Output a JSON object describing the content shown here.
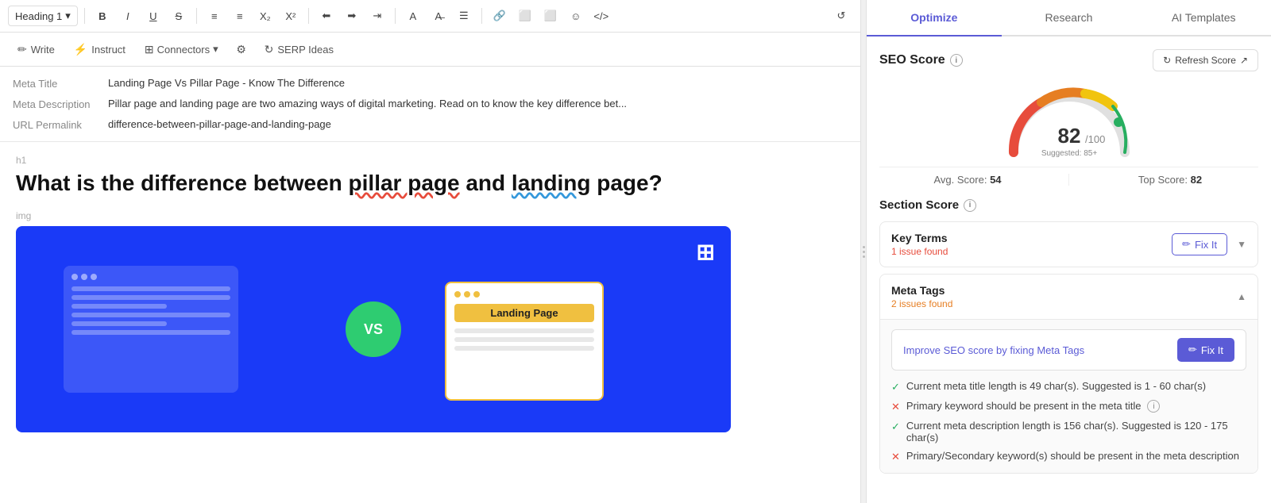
{
  "toolbar": {
    "heading_label": "Heading 1",
    "buttons": [
      "B",
      "I",
      "U",
      "S",
      "OL",
      "UL",
      "X₂",
      "X²",
      "Align-L",
      "Align-R",
      "Indent",
      "Color",
      "Clear",
      "Align",
      "Link",
      "Image",
      "Media",
      "Emoji",
      "Code"
    ],
    "history_icon": "↺"
  },
  "secondary_toolbar": {
    "write_label": "Write",
    "instruct_label": "Instruct",
    "connectors_label": "Connectors",
    "settings_icon": "⚙",
    "serp_label": "SERP Ideas"
  },
  "meta": {
    "title_label": "Meta Title",
    "title_value": "Landing Page Vs Pillar Page - Know The Difference",
    "description_label": "Meta Description",
    "description_value": "Pillar page and landing page are two amazing ways of digital marketing. Read on to know the key difference bet...",
    "url_label": "URL Permalink",
    "url_value": "difference-between-pillar-page-and-landing-page"
  },
  "content": {
    "h1_indicator": "h1",
    "img_indicator": "img",
    "title_part1": "What is the difference between ",
    "title_highlight1": "pillar page",
    "title_part2": " and ",
    "title_highlight2": "landing",
    "title_part3": " page?",
    "vs_text": "VS",
    "landing_page_label": "Landing Page"
  },
  "right_panel": {
    "tabs": [
      {
        "label": "Optimize",
        "active": true
      },
      {
        "label": "Research",
        "active": false
      },
      {
        "label": "AI Templates",
        "active": false
      }
    ],
    "seo_score": {
      "title": "SEO Score",
      "refresh_label": "Refresh Score",
      "score": "82",
      "score_max": "/100",
      "suggested": "Suggested: 85+",
      "avg_score_label": "Avg. Score:",
      "avg_score_value": "54",
      "top_score_label": "Top Score:",
      "top_score_value": "82"
    },
    "section_score": {
      "title": "Section Score",
      "items": [
        {
          "name": "Key Terms",
          "issues": "1 issue found",
          "fix_label": "Fix It",
          "expanded": false
        },
        {
          "name": "Meta Tags",
          "issues": "2 issues found",
          "fix_label": "Fix It",
          "expanded": true,
          "improve_text": "Improve SEO score by fixing Meta Tags",
          "fix_primary_label": "Fix It",
          "checks": [
            {
              "pass": true,
              "text": "Current meta title length is 49 char(s). Suggested is 1 - 60 char(s)"
            },
            {
              "pass": false,
              "text": "Primary keyword should be present in the meta title"
            },
            {
              "pass": true,
              "text": "Current meta description length is 156 char(s). Suggested is 120 - 175 char(s)"
            },
            {
              "pass": false,
              "text": "Primary/Secondary keyword(s) should be present in the meta description"
            }
          ]
        }
      ]
    }
  }
}
